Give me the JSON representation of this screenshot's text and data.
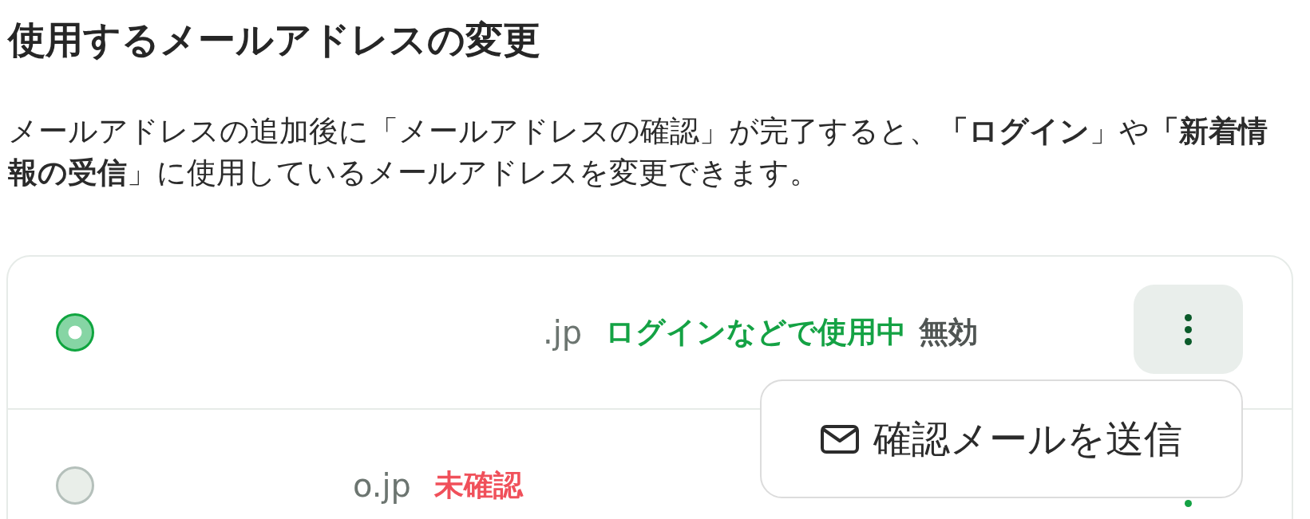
{
  "heading": "使用するメールアドレスの変更",
  "description": "メールアドレスの追加後に「メールアドレスの確認」が完了すると、**「ログイン**」や**「新着情報の受信**」に使用しているメールアドレスを変更できます。",
  "addresses": [
    {
      "address": ".jp",
      "selected": true,
      "badges": [
        {
          "text": "ログインなどで使用中",
          "kind": "in-use"
        },
        {
          "text": "無効",
          "kind": "disabled"
        }
      ],
      "menu_open": true,
      "menu_items": [
        {
          "label": "確認メールを送信"
        }
      ]
    },
    {
      "address": "o.jp",
      "selected": false,
      "badges": [
        {
          "text": "未確認",
          "kind": "unverified"
        }
      ],
      "menu_open": false
    }
  ]
}
